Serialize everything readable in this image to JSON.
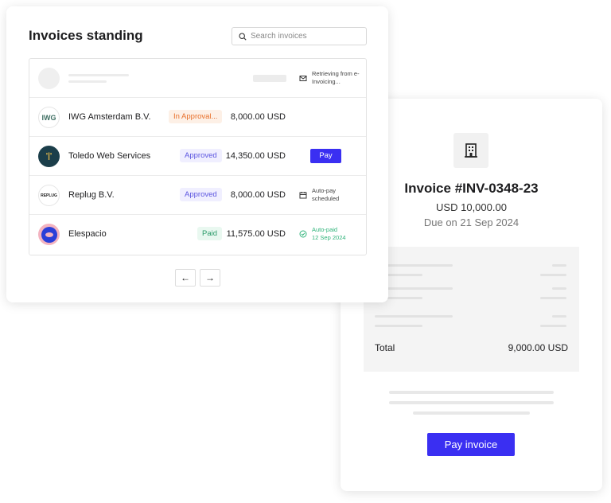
{
  "invoices": {
    "title": "Invoices standing",
    "search_placeholder": "Search invoices",
    "loading_status": "Retrieving from e-Invoicing...",
    "rows": [
      {
        "name": "IWG Amsterdam B.V.",
        "logo": "IWG",
        "badge": "In Approval...",
        "amount": "8,000.00 USD"
      },
      {
        "name": "Toledo Web Services",
        "logo": "'|'",
        "badge": "Approved",
        "amount": "14,350.00 USD",
        "action": "Pay"
      },
      {
        "name": "Replug B.V.",
        "logo": "REPLUG",
        "badge": "Approved",
        "amount": "8,000.00 USD",
        "status": "Auto-pay scheduled"
      },
      {
        "name": "Elespacio",
        "badge": "Paid",
        "amount": "11,575.00 USD",
        "status": "Auto-paid",
        "status_date": "12 Sep 2024"
      }
    ],
    "prev_icon": "arrow-left-icon",
    "next_icon": "arrow-right-icon"
  },
  "invoice": {
    "title": "Invoice #INV-0348-23",
    "amount": "USD 10,000.00",
    "due": "Due on 21 Sep 2024",
    "total_label": "Total",
    "total_value": "9,000.00 USD",
    "pay_label": "Pay invoice"
  },
  "colors": {
    "accent": "#3a2ff2",
    "approval": "#e8702a",
    "approved": "#5b55e0",
    "paid": "#2fb37a"
  }
}
